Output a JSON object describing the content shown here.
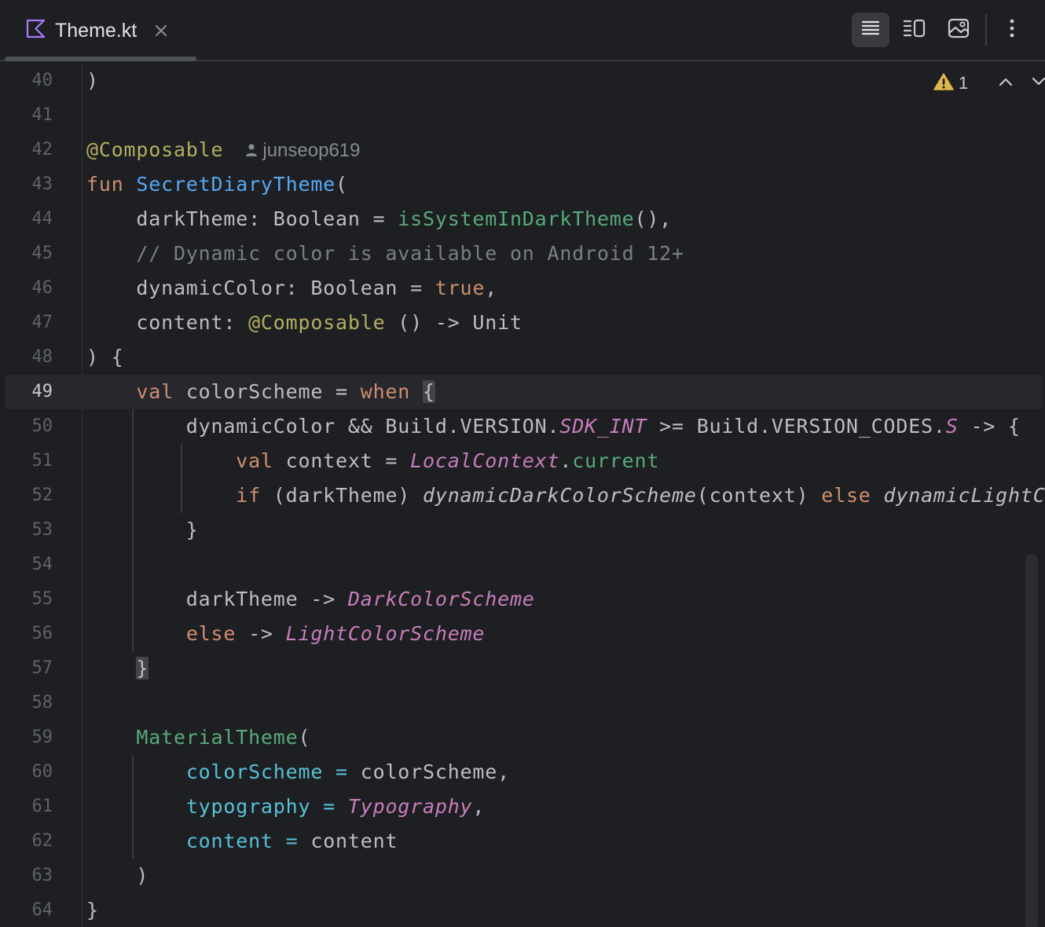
{
  "tab": {
    "file_name": "Theme.kt",
    "icon": "kotlin-file-icon",
    "close_icon": "close-icon"
  },
  "toolbar": {
    "buttons": [
      {
        "icon": "code-view-icon",
        "active": true
      },
      {
        "icon": "split-view-icon",
        "active": false
      },
      {
        "icon": "design-view-icon",
        "active": false
      },
      {
        "icon": "more-vertical-icon",
        "active": false
      }
    ]
  },
  "inspections": {
    "icon": "warning-icon",
    "count": "1"
  },
  "current_line": "49",
  "author": "junseop619",
  "colors": {
    "background": "#1e1f22",
    "keyword": "#cf8e6d",
    "function": "#56a8f5",
    "annotation": "#b3ae60",
    "property": "#c77dbb",
    "comment": "#7a7e85",
    "warning": "#e0b74c"
  },
  "lines": [
    {
      "n": "40",
      "t": [
        [
          ")",
          ""
        ]
      ]
    },
    {
      "n": "41",
      "t": []
    },
    {
      "n": "42",
      "t": [
        [
          "@Composable",
          "an"
        ]
      ],
      "author": true
    },
    {
      "n": "43",
      "t": [
        [
          "fun ",
          "kw"
        ],
        [
          "SecretDiaryTheme",
          "fn"
        ],
        [
          "(",
          ""
        ]
      ]
    },
    {
      "n": "44",
      "t": [
        [
          "    darkTheme: Boolean = ",
          ""
        ],
        [
          "isSystemInDarkTheme",
          "fc"
        ],
        [
          "(),",
          ""
        ]
      ]
    },
    {
      "n": "45",
      "t": [
        [
          "    // Dynamic color is available on Android 12+",
          "cm"
        ]
      ]
    },
    {
      "n": "46",
      "t": [
        [
          "    dynamicColor: Boolean = ",
          ""
        ],
        [
          "true",
          "kw"
        ],
        [
          ",",
          ""
        ]
      ]
    },
    {
      "n": "47",
      "t": [
        [
          "    content: ",
          ""
        ],
        [
          "@Composable",
          "an"
        ],
        [
          " () -> Unit",
          ""
        ]
      ]
    },
    {
      "n": "48",
      "t": [
        [
          ") {",
          ""
        ]
      ]
    },
    {
      "n": "49",
      "t": [
        [
          "    ",
          ""
        ],
        [
          "val ",
          "kw"
        ],
        [
          "colorScheme = ",
          ""
        ],
        [
          "when ",
          "kw"
        ],
        [
          "{",
          "brace-hl"
        ]
      ]
    },
    {
      "n": "50",
      "t": [
        [
          "        dynamicColor && Build.VERSION.",
          ""
        ],
        [
          "SDK_INT",
          "pr"
        ],
        [
          " >= Build.VERSION_CODES.",
          ""
        ],
        [
          "S",
          "pr"
        ],
        [
          " -> {",
          ""
        ]
      ]
    },
    {
      "n": "51",
      "t": [
        [
          "            ",
          ""
        ],
        [
          "val ",
          "kw"
        ],
        [
          "context = ",
          ""
        ],
        [
          "LocalContext",
          "pr"
        ],
        [
          ".",
          ""
        ],
        [
          "current",
          "fc"
        ]
      ]
    },
    {
      "n": "52",
      "t": [
        [
          "            ",
          ""
        ],
        [
          "if ",
          "kw"
        ],
        [
          "(darkTheme) ",
          ""
        ],
        [
          "dynamicDarkColorScheme",
          "it"
        ],
        [
          "(context) ",
          ""
        ],
        [
          "else ",
          "kw"
        ],
        [
          "dynamicLightColorScheme(context)",
          "it"
        ]
      ]
    },
    {
      "n": "53",
      "t": [
        [
          "        }",
          ""
        ]
      ]
    },
    {
      "n": "54",
      "t": []
    },
    {
      "n": "55",
      "t": [
        [
          "        darkTheme -> ",
          ""
        ],
        [
          "DarkColorScheme",
          "pr"
        ]
      ]
    },
    {
      "n": "56",
      "t": [
        [
          "        ",
          ""
        ],
        [
          "else ",
          "kw"
        ],
        [
          "-> ",
          ""
        ],
        [
          "LightColorScheme",
          "pr"
        ]
      ]
    },
    {
      "n": "57",
      "t": [
        [
          "    ",
          ""
        ],
        [
          "}",
          "brace-hl"
        ]
      ]
    },
    {
      "n": "58",
      "t": []
    },
    {
      "n": "59",
      "t": [
        [
          "    ",
          ""
        ],
        [
          "MaterialTheme",
          "fc"
        ],
        [
          "(",
          ""
        ]
      ]
    },
    {
      "n": "60",
      "t": [
        [
          "        ",
          ""
        ],
        [
          "colorScheme",
          "na"
        ],
        [
          " = ",
          "na"
        ],
        [
          "colorScheme,",
          ""
        ]
      ]
    },
    {
      "n": "61",
      "t": [
        [
          "        ",
          ""
        ],
        [
          "typography",
          "na"
        ],
        [
          " = ",
          "na"
        ],
        [
          "Typography",
          "pr"
        ],
        [
          ",",
          ""
        ]
      ]
    },
    {
      "n": "62",
      "t": [
        [
          "        ",
          ""
        ],
        [
          "content",
          "na"
        ],
        [
          " = ",
          "na"
        ],
        [
          "content",
          ""
        ]
      ]
    },
    {
      "n": "63",
      "t": [
        [
          "    )",
          ""
        ]
      ]
    },
    {
      "n": "64",
      "t": [
        [
          "}",
          ""
        ]
      ]
    }
  ]
}
